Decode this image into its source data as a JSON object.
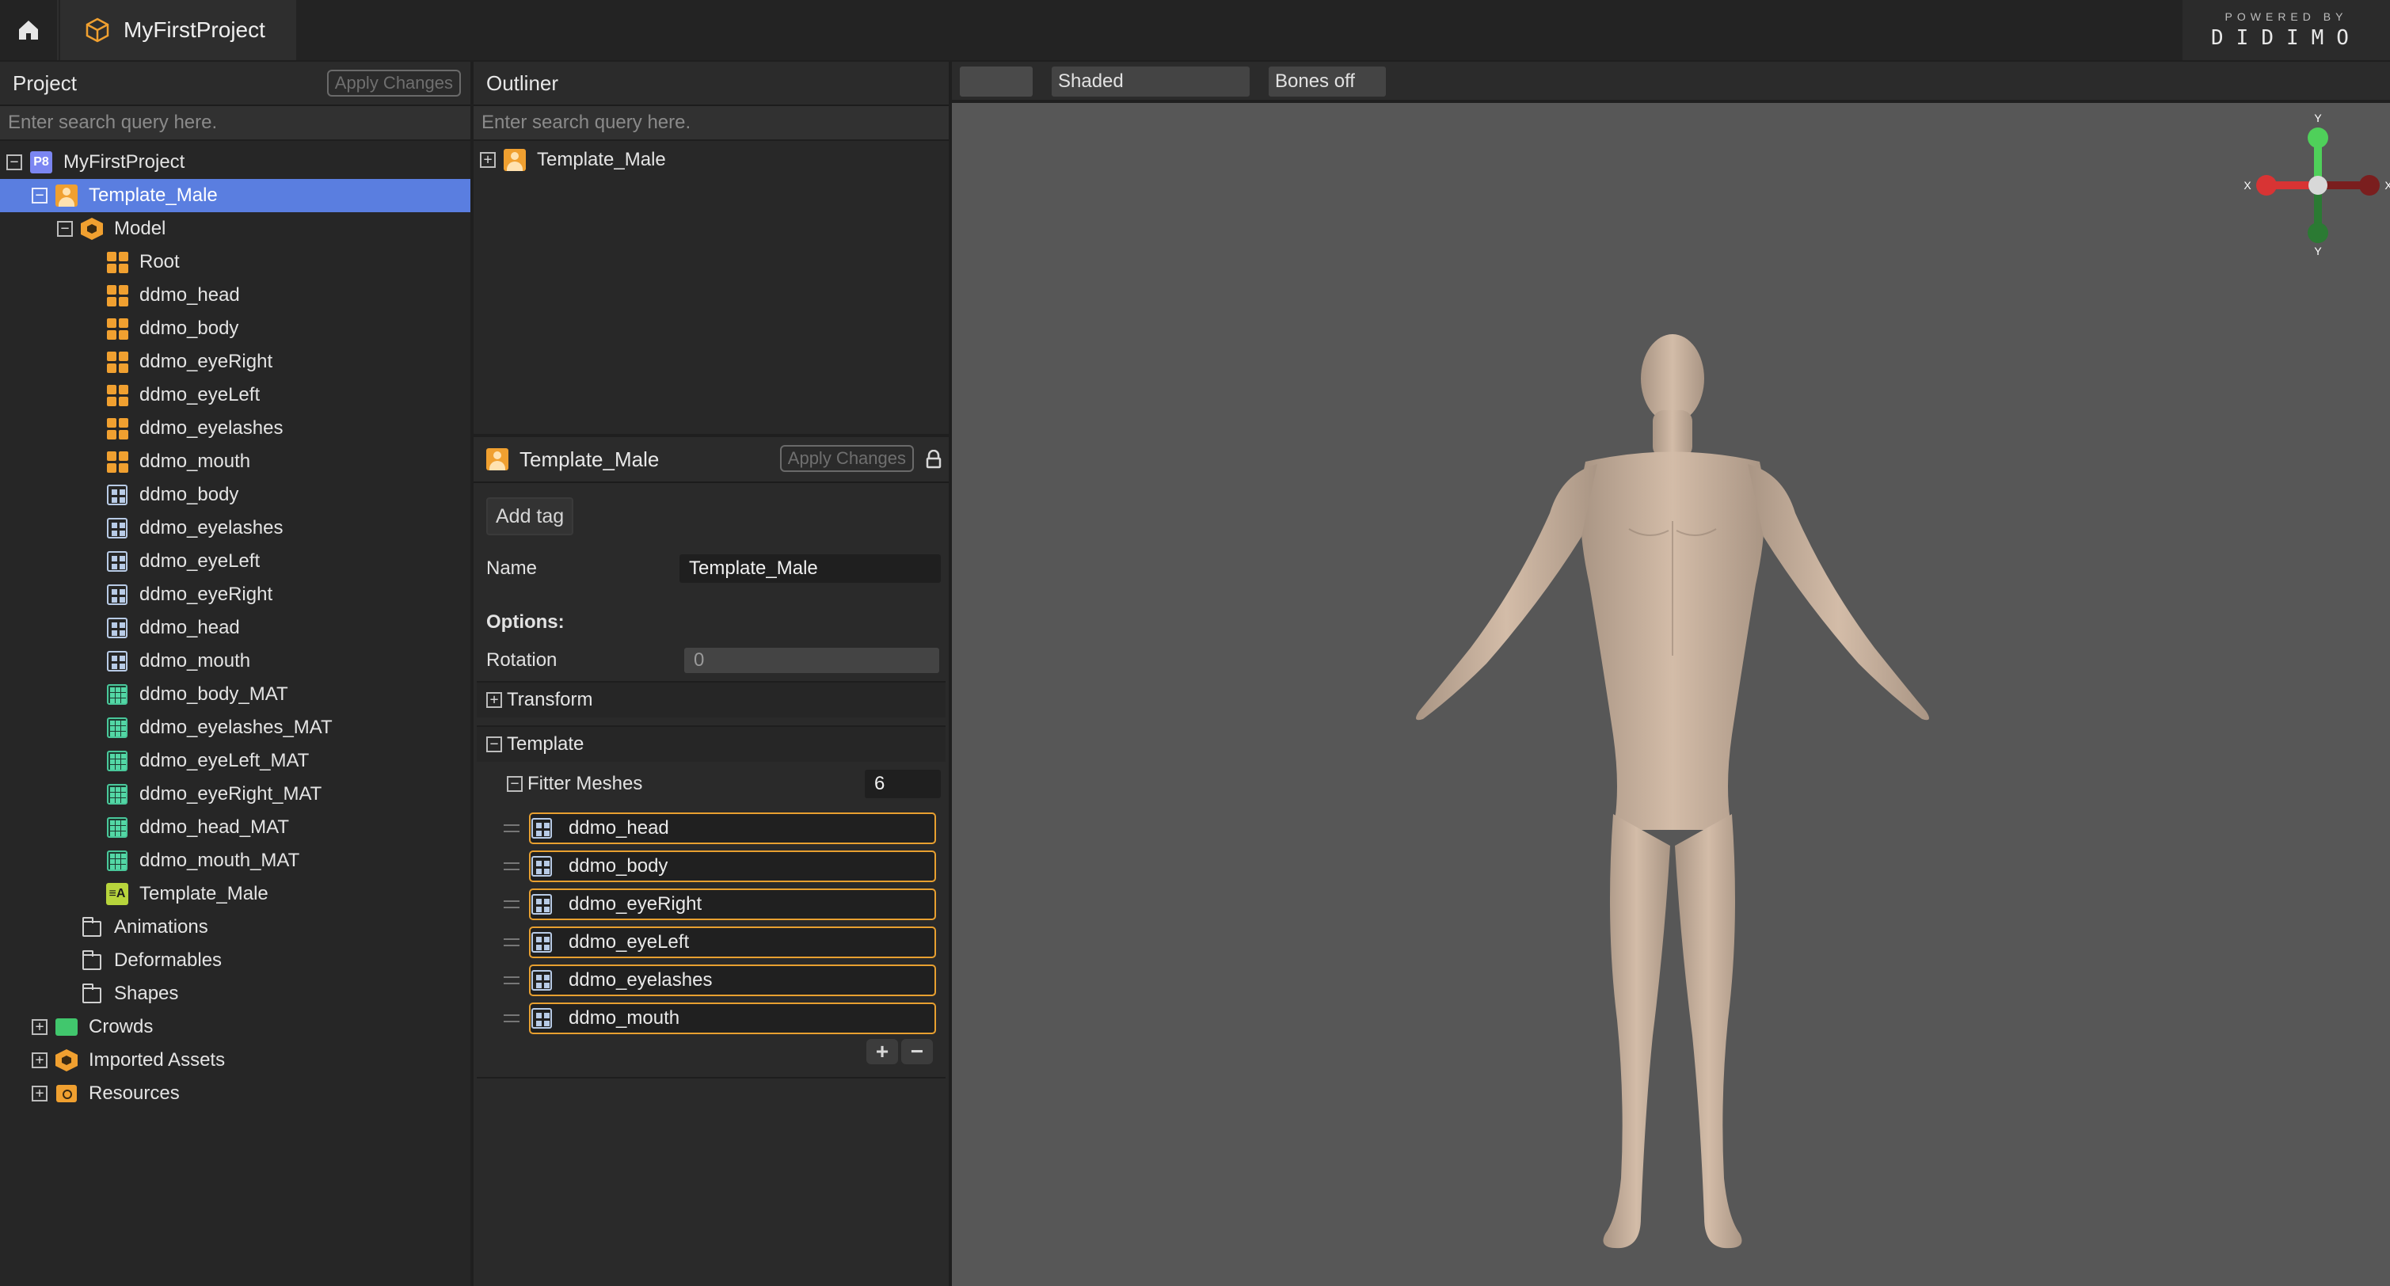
{
  "app": {
    "project_tab_label": "MyFirstProject",
    "brand_powered": "POWERED BY",
    "brand_name": "DIDIMO"
  },
  "project_panel": {
    "title": "Project",
    "apply_label": "Apply Changes",
    "search_placeholder": "Enter search query here.",
    "tree": [
      {
        "label": "MyFirstProject",
        "indent": 0,
        "toggle": "−",
        "icon": "p8-project-icon"
      },
      {
        "label": "Template_Male",
        "indent": 1,
        "toggle": "−",
        "icon": "person-icon",
        "selected": true
      },
      {
        "label": "Model",
        "indent": 2,
        "toggle": "−",
        "icon": "model-hex-icon"
      },
      {
        "label": "Root",
        "indent": 3,
        "icon": "node-orange-icon"
      },
      {
        "label": "ddmo_head",
        "indent": 3,
        "icon": "node-orange-icon"
      },
      {
        "label": "ddmo_body",
        "indent": 3,
        "icon": "node-orange-icon"
      },
      {
        "label": "ddmo_eyeRight",
        "indent": 3,
        "icon": "node-orange-icon"
      },
      {
        "label": "ddmo_eyeLeft",
        "indent": 3,
        "icon": "node-orange-icon"
      },
      {
        "label": "ddmo_eyelashes",
        "indent": 3,
        "icon": "node-orange-icon"
      },
      {
        "label": "ddmo_mouth",
        "indent": 3,
        "icon": "node-orange-icon"
      },
      {
        "label": "ddmo_body",
        "indent": 3,
        "icon": "mesh-icon"
      },
      {
        "label": "ddmo_eyelashes",
        "indent": 3,
        "icon": "mesh-icon"
      },
      {
        "label": "ddmo_eyeLeft",
        "indent": 3,
        "icon": "mesh-icon"
      },
      {
        "label": "ddmo_eyeRight",
        "indent": 3,
        "icon": "mesh-icon"
      },
      {
        "label": "ddmo_head",
        "indent": 3,
        "icon": "mesh-icon"
      },
      {
        "label": "ddmo_mouth",
        "indent": 3,
        "icon": "mesh-icon"
      },
      {
        "label": "ddmo_body_MAT",
        "indent": 3,
        "icon": "material-icon"
      },
      {
        "label": "ddmo_eyelashes_MAT",
        "indent": 3,
        "icon": "material-icon"
      },
      {
        "label": "ddmo_eyeLeft_MAT",
        "indent": 3,
        "icon": "material-icon"
      },
      {
        "label": "ddmo_eyeRight_MAT",
        "indent": 3,
        "icon": "material-icon"
      },
      {
        "label": "ddmo_head_MAT",
        "indent": 3,
        "icon": "material-icon"
      },
      {
        "label": "ddmo_mouth_MAT",
        "indent": 3,
        "icon": "material-icon"
      },
      {
        "label": "Template_Male",
        "indent": 3,
        "icon": "template-icon"
      },
      {
        "label": "Animations",
        "indent": 2,
        "icon": "folder-icon"
      },
      {
        "label": "Deformables",
        "indent": 2,
        "icon": "folder-icon"
      },
      {
        "label": "Shapes",
        "indent": 2,
        "icon": "folder-icon"
      },
      {
        "label": "Crowds",
        "indent": 1,
        "toggle": "+",
        "icon": "crowd-icon"
      },
      {
        "label": "Imported Assets",
        "indent": 1,
        "toggle": "+",
        "icon": "imported-assets-icon"
      },
      {
        "label": "Resources",
        "indent": 1,
        "toggle": "+",
        "icon": "resources-icon"
      }
    ]
  },
  "outliner": {
    "title": "Outliner",
    "search_placeholder": "Enter search query here.",
    "items": [
      {
        "label": "Template_Male",
        "toggle": "+",
        "icon": "person-icon"
      }
    ]
  },
  "inspector": {
    "title": "Template_Male",
    "apply_label": "Apply Changes",
    "add_tag_label": "Add tag",
    "name_label": "Name",
    "name_value": "Template_Male",
    "options_label": "Options:",
    "rotation_label": "Rotation",
    "rotation_value": "0",
    "transform_label": "Transform",
    "template_label": "Template",
    "fitter_meshes_label": "Fitter Meshes",
    "fitter_meshes_count": "6",
    "fitter_meshes": [
      "ddmo_head",
      "ddmo_body",
      "ddmo_eyeRight",
      "ddmo_eyeLeft",
      "ddmo_eyelashes",
      "ddmo_mouth"
    ],
    "add_symbol": "+",
    "remove_symbol": "−"
  },
  "viewport": {
    "camera_value": "",
    "shading_mode": "Shaded",
    "bones_mode": "Bones off",
    "gizmo_axes": {
      "up": "Y",
      "down": "Y",
      "left": "X",
      "right": "X"
    }
  },
  "colors": {
    "accent_selection": "#5a7ee0",
    "orange": "#f0a030",
    "mesh_outline": "#e8a030",
    "gizmo_x": "#d83434",
    "gizmo_y": "#4fd05a",
    "skin": "#cdb5a0"
  }
}
